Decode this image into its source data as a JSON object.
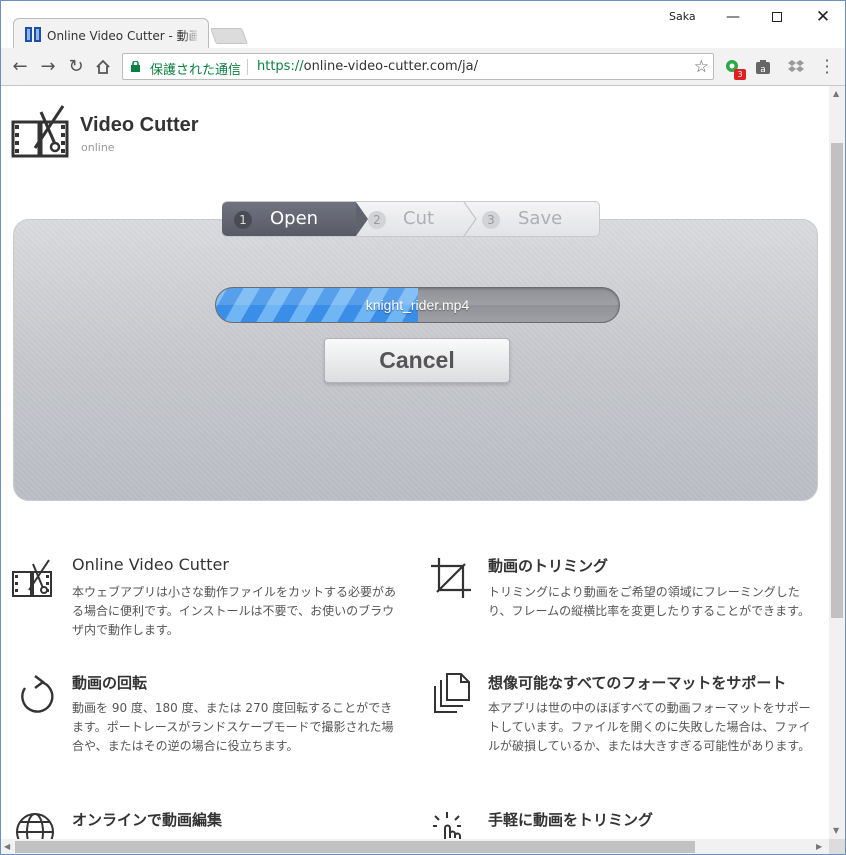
{
  "browser": {
    "tab_title": "Online Video Cutter - 動画",
    "user": "Saka",
    "secure_label": "保護された通信",
    "url_prefix": "https://",
    "url_main": "online-video-cutter.com/ja/",
    "ext_badge": "3"
  },
  "site": {
    "brand": "Video Cutter",
    "brand_sub": "online"
  },
  "steps": [
    {
      "num": "1",
      "label": "Open"
    },
    {
      "num": "2",
      "label": "Cut"
    },
    {
      "num": "3",
      "label": "Save"
    }
  ],
  "upload": {
    "filename": "knight_rider.mp4",
    "progress": 0.5,
    "cancel_label": "Cancel"
  },
  "features": [
    {
      "title": "Online Video Cutter",
      "desc": "本ウェブアプリは小さな動作ファイルをカットする必要がある場合に便利です。インストールは不要で、お使いのブラウザ内で動作します。"
    },
    {
      "title": "動画のトリミング",
      "desc": "トリミングにより動画をご希望の領域にフレーミングしたり、フレームの縦横比率を変更したりすることができます。"
    },
    {
      "title": "動画の回転",
      "desc": "動画を 90 度、180 度、または 270 度回転することができます。ポートレースがランドスケープモードで撮影された場合や、またはその逆の場合に役立ちます。"
    },
    {
      "title": "想像可能なすべてのフォーマットをサポート",
      "desc": "本アプリは世の中のほぼすべての動画フォーマットをサポートしています。ファイルを開くのに失敗した場合は、ファイルが破損しているか、または大きすぎる可能性があります。"
    },
    {
      "title": "オンラインで動画編集",
      "desc": ""
    },
    {
      "title": "手軽に動画をトリミング",
      "desc": ""
    }
  ]
}
